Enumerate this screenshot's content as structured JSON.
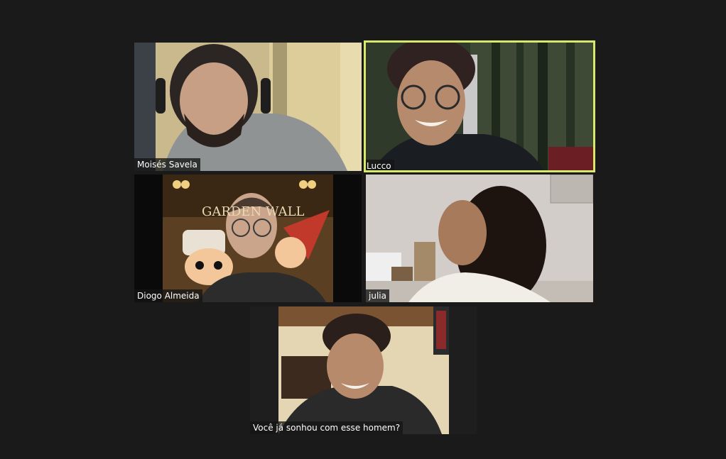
{
  "participants": [
    {
      "name": "Moisés Savela",
      "active_speaker": false
    },
    {
      "name": "Lucco",
      "active_speaker": true
    },
    {
      "name": "Diogo Almeida",
      "active_speaker": false
    },
    {
      "name": "julia",
      "active_speaker": false
    },
    {
      "name": "Você já sonhou com esse homem?",
      "active_speaker": false
    }
  ],
  "colors": {
    "background": "#1a1a1a",
    "active_speaker_border": "#d7e86a",
    "name_tag_text": "#ffffff"
  },
  "poster_text": "GARDEN WALL"
}
